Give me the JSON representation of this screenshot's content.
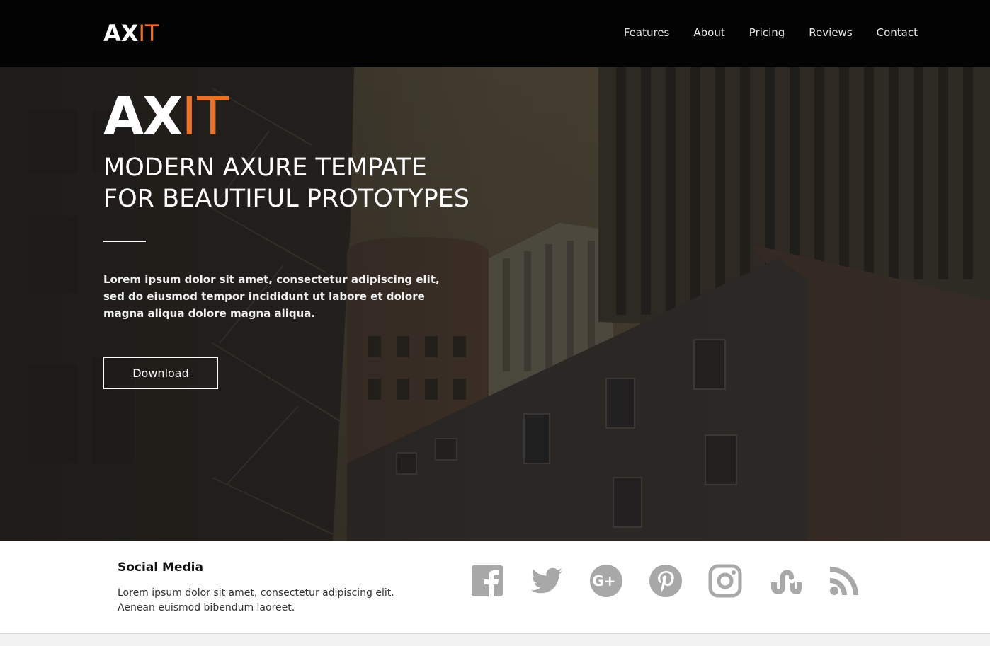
{
  "header": {
    "logo_ax": "AX",
    "logo_it": "IT",
    "nav": [
      "Features",
      "About",
      "Pricing",
      "Reviews",
      "Contact"
    ]
  },
  "hero": {
    "logo_ax": "AX",
    "logo_it": "IT",
    "title_line1": "MODERN AXURE TEMPATE",
    "title_line2": "FOR BEAUTIFUL PROTOTYPES",
    "text": "Lorem ipsum dolor sit amet, consectetur adipiscing elit, sed do eiusmod tempor incididunt ut labore et dolore magna aliqua dolore magna aliqua.",
    "download_label": "Download"
  },
  "social": {
    "title": "Social Media",
    "text": "Lorem ipsum dolor sit amet, consectetur adipiscing elit. Aenean euismod bibendum laoreet.",
    "icons": [
      "facebook-icon",
      "twitter-icon",
      "google-plus-icon",
      "pinterest-icon",
      "instagram-icon",
      "stumbleupon-icon",
      "rss-icon"
    ]
  },
  "colors": {
    "accent": "#e8722a",
    "header_bg": "#030303",
    "icon_gray": "#a8a8a8"
  }
}
